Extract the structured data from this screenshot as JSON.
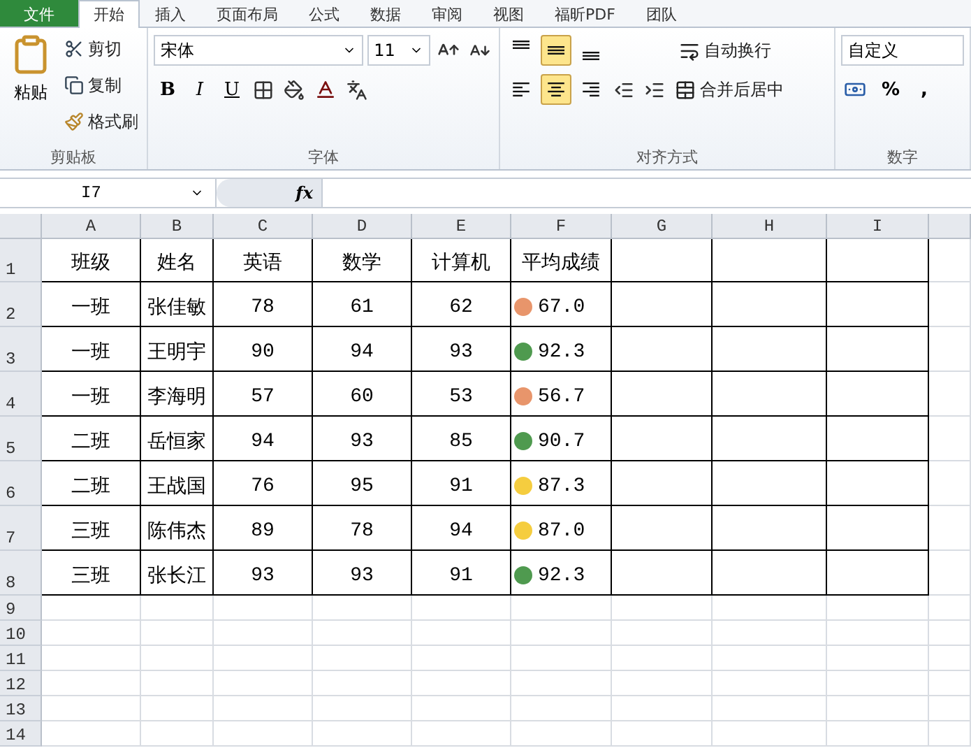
{
  "tabs": [
    {
      "label": "文件",
      "kind": "file",
      "selected": false
    },
    {
      "label": "开始",
      "kind": "tab",
      "selected": true
    },
    {
      "label": "插入",
      "kind": "tab",
      "selected": false
    },
    {
      "label": "页面布局",
      "kind": "tab",
      "selected": false
    },
    {
      "label": "公式",
      "kind": "tab",
      "selected": false
    },
    {
      "label": "数据",
      "kind": "tab",
      "selected": false
    },
    {
      "label": "审阅",
      "kind": "tab",
      "selected": false
    },
    {
      "label": "视图",
      "kind": "tab",
      "selected": false
    },
    {
      "label": "福昕PDF",
      "kind": "tab",
      "selected": false
    },
    {
      "label": "团队",
      "kind": "tab",
      "selected": false
    }
  ],
  "clipboard": {
    "paste": "粘贴",
    "cut": "剪切",
    "copy": "复制",
    "format_painter": "格式刷",
    "label": "剪贴板"
  },
  "font": {
    "name": "宋体",
    "size": "11",
    "bold": "B",
    "italic": "I",
    "underline": "U",
    "label": "字体"
  },
  "alignment": {
    "vertical": [
      {
        "kind": "top",
        "selected": false
      },
      {
        "kind": "middle",
        "selected": true
      },
      {
        "kind": "bottom",
        "selected": false
      }
    ],
    "horizontal": [
      {
        "kind": "left",
        "selected": false
      },
      {
        "kind": "center",
        "selected": true
      },
      {
        "kind": "right",
        "selected": false
      }
    ],
    "wrap": "自动换行",
    "merge": "合并后居中",
    "label": "对齐方式"
  },
  "number": {
    "format": "自定义",
    "percent": "%",
    "comma": ",",
    "label": "数字"
  },
  "name_box": "I7",
  "formula_label": "fx",
  "columns": [
    "A",
    "B",
    "C",
    "D",
    "E",
    "F",
    "G",
    "H",
    "I"
  ],
  "header_row": {
    "number": "1",
    "cells": [
      "班级",
      "姓名",
      "英语",
      "数学",
      "计算机",
      "平均成绩"
    ]
  },
  "data_rows": [
    {
      "number": "2",
      "cells": [
        "一班",
        "张佳敏",
        "78",
        "61",
        "62"
      ],
      "average": "67.0",
      "color": "#e8956b"
    },
    {
      "number": "3",
      "cells": [
        "一班",
        "王明宇",
        "90",
        "94",
        "93"
      ],
      "average": "92.3",
      "color": "#4f9a4f"
    },
    {
      "number": "4",
      "cells": [
        "一班",
        "李海明",
        "57",
        "60",
        "53"
      ],
      "average": "56.7",
      "color": "#e8956b"
    },
    {
      "number": "5",
      "cells": [
        "二班",
        "岳恒家",
        "94",
        "93",
        "85"
      ],
      "average": "90.7",
      "color": "#4f9a4f"
    },
    {
      "number": "6",
      "cells": [
        "二班",
        "王战国",
        "76",
        "95",
        "91"
      ],
      "average": "87.3",
      "color": "#f5cd3f"
    },
    {
      "number": "7",
      "cells": [
        "三班",
        "陈伟杰",
        "89",
        "78",
        "94"
      ],
      "average": "87.0",
      "color": "#f5cd3f"
    },
    {
      "number": "8",
      "cells": [
        "三班",
        "张长江",
        "93",
        "93",
        "91"
      ],
      "average": "92.3",
      "color": "#4f9a4f"
    }
  ],
  "empty_rows": [
    "9",
    "10",
    "11",
    "12",
    "13",
    "14"
  ]
}
